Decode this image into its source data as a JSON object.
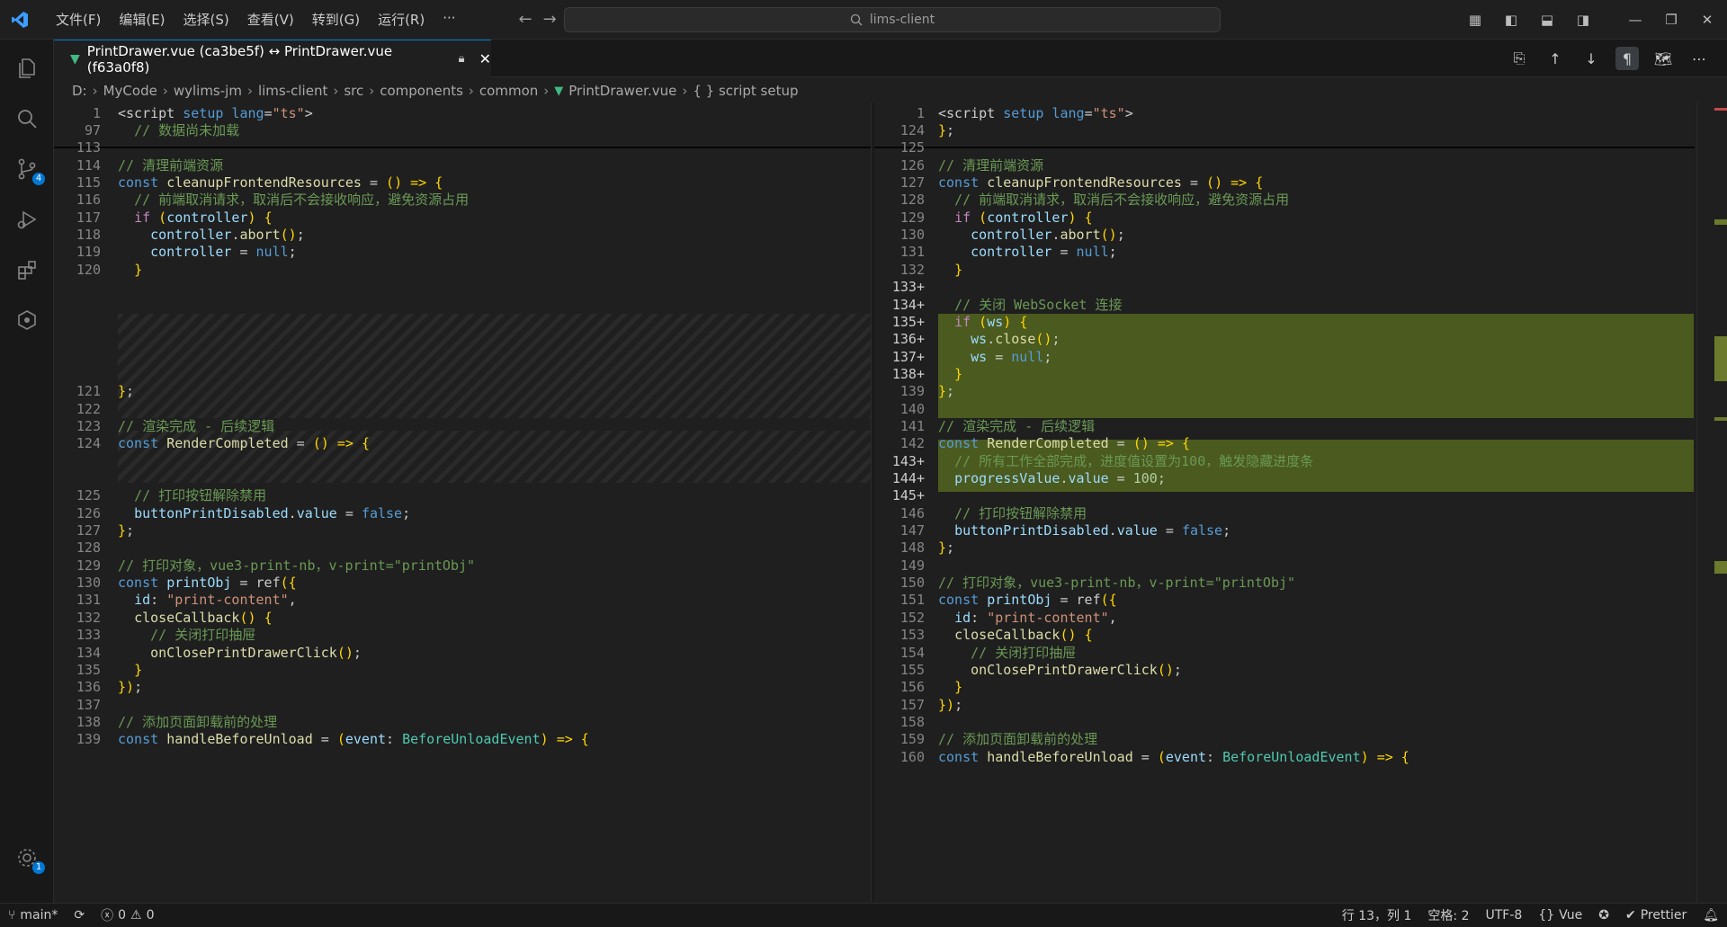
{
  "menu": [
    "文件(F)",
    "编辑(E)",
    "选择(S)",
    "查看(V)",
    "转到(G)",
    "运行(R)",
    "···"
  ],
  "search": {
    "text": "lims-client"
  },
  "tab": {
    "label": "PrintDrawer.vue (ca3be5f) ↔ PrintDrawer.vue (f63a0f8)"
  },
  "breadcrumb": [
    "D:",
    "MyCode",
    "wylims-jm",
    "lims-client",
    "src",
    "components",
    "common",
    "PrintDrawer.vue",
    "{ } script setup"
  ],
  "activity_badges": {
    "scm": "4",
    "settings": "1"
  },
  "left_lines": [
    {
      "n": "1",
      "t": "<script setup lang=\"ts\">"
    },
    {
      "n": "97",
      "t": "  // 数据尚未加载"
    },
    {
      "n": "113",
      "t": ""
    },
    {
      "n": "114",
      "t": "// 清理前端资源"
    },
    {
      "n": "115",
      "t": "const cleanupFrontendResources = () => {"
    },
    {
      "n": "116",
      "t": "  // 前端取消请求，取消后不会接收响应，避免资源占用"
    },
    {
      "n": "117",
      "t": "  if (controller) {"
    },
    {
      "n": "118",
      "t": "    controller.abort();"
    },
    {
      "n": "119",
      "t": "    controller = null;"
    },
    {
      "n": "120",
      "t": "  }"
    },
    {
      "n": "121",
      "t": "};"
    },
    {
      "n": "122",
      "t": ""
    },
    {
      "n": "123",
      "t": "// 渲染完成 - 后续逻辑"
    },
    {
      "n": "124",
      "t": "const RenderCompleted = () => {"
    },
    {
      "n": "125",
      "t": "  // 打印按钮解除禁用"
    },
    {
      "n": "126",
      "t": "  buttonPrintDisabled.value = false;"
    },
    {
      "n": "127",
      "t": "};"
    },
    {
      "n": "128",
      "t": ""
    },
    {
      "n": "129",
      "t": "// 打印对象，vue3-print-nb，v-print=\"printObj\""
    },
    {
      "n": "130",
      "t": "const printObj = ref({"
    },
    {
      "n": "131",
      "t": "  id: \"print-content\","
    },
    {
      "n": "132",
      "t": "  closeCallback() {"
    },
    {
      "n": "133",
      "t": "    // 关闭打印抽屉"
    },
    {
      "n": "134",
      "t": "    onClosePrintDrawerClick();"
    },
    {
      "n": "135",
      "t": "  }"
    },
    {
      "n": "136",
      "t": "});"
    },
    {
      "n": "137",
      "t": ""
    },
    {
      "n": "138",
      "t": "// 添加页面卸载前的处理"
    },
    {
      "n": "139",
      "t": "const handleBeforeUnload = (event: BeforeUnloadEvent) => {"
    }
  ],
  "right_lines": [
    {
      "n": "1",
      "t": "<script setup lang=\"ts\">"
    },
    {
      "n": "124",
      "t": "};"
    },
    {
      "n": "125",
      "t": ""
    },
    {
      "n": "126",
      "t": "// 清理前端资源"
    },
    {
      "n": "127",
      "t": "const cleanupFrontendResources = () => {"
    },
    {
      "n": "128",
      "t": "  // 前端取消请求，取消后不会接收响应，避免资源占用"
    },
    {
      "n": "129",
      "t": "  if (controller) {"
    },
    {
      "n": "130",
      "t": "    controller.abort();"
    },
    {
      "n": "131",
      "t": "    controller = null;"
    },
    {
      "n": "132",
      "t": "  }"
    },
    {
      "n": "133+",
      "t": ""
    },
    {
      "n": "134+",
      "t": "  // 关闭 WebSocket 连接"
    },
    {
      "n": "135+",
      "t": "  if (ws) {"
    },
    {
      "n": "136+",
      "t": "    ws.close();"
    },
    {
      "n": "137+",
      "t": "    ws = null;"
    },
    {
      "n": "138+",
      "t": "  }"
    },
    {
      "n": "139",
      "t": "};"
    },
    {
      "n": "140",
      "t": ""
    },
    {
      "n": "141",
      "t": "// 渲染完成 - 后续逻辑"
    },
    {
      "n": "142",
      "t": "const RenderCompleted = () => {"
    },
    {
      "n": "143+",
      "t": "  // 所有工作全部完成，进度值设置为100，触发隐藏进度条"
    },
    {
      "n": "144+",
      "t": "  progressValue.value = 100;"
    },
    {
      "n": "145+",
      "t": ""
    },
    {
      "n": "146",
      "t": "  // 打印按钮解除禁用"
    },
    {
      "n": "147",
      "t": "  buttonPrintDisabled.value = false;"
    },
    {
      "n": "148",
      "t": "};"
    },
    {
      "n": "149",
      "t": ""
    },
    {
      "n": "150",
      "t": "// 打印对象，vue3-print-nb，v-print=\"printObj\""
    },
    {
      "n": "151",
      "t": "const printObj = ref({"
    },
    {
      "n": "152",
      "t": "  id: \"print-content\","
    },
    {
      "n": "153",
      "t": "  closeCallback() {"
    },
    {
      "n": "154",
      "t": "    // 关闭打印抽屉"
    },
    {
      "n": "155",
      "t": "    onClosePrintDrawerClick();"
    },
    {
      "n": "156",
      "t": "  }"
    },
    {
      "n": "157",
      "t": "});"
    },
    {
      "n": "158",
      "t": ""
    },
    {
      "n": "159",
      "t": "// 添加页面卸载前的处理"
    },
    {
      "n": "160",
      "t": "const handleBeforeUnload = (event: BeforeUnloadEvent) => {"
    }
  ],
  "status": {
    "branch": "main*",
    "errors": "0",
    "warnings": "0",
    "position": "行 13，列 1",
    "indent": "空格: 2",
    "encoding": "UTF-8",
    "language": "Vue",
    "formatter": "Prettier"
  }
}
